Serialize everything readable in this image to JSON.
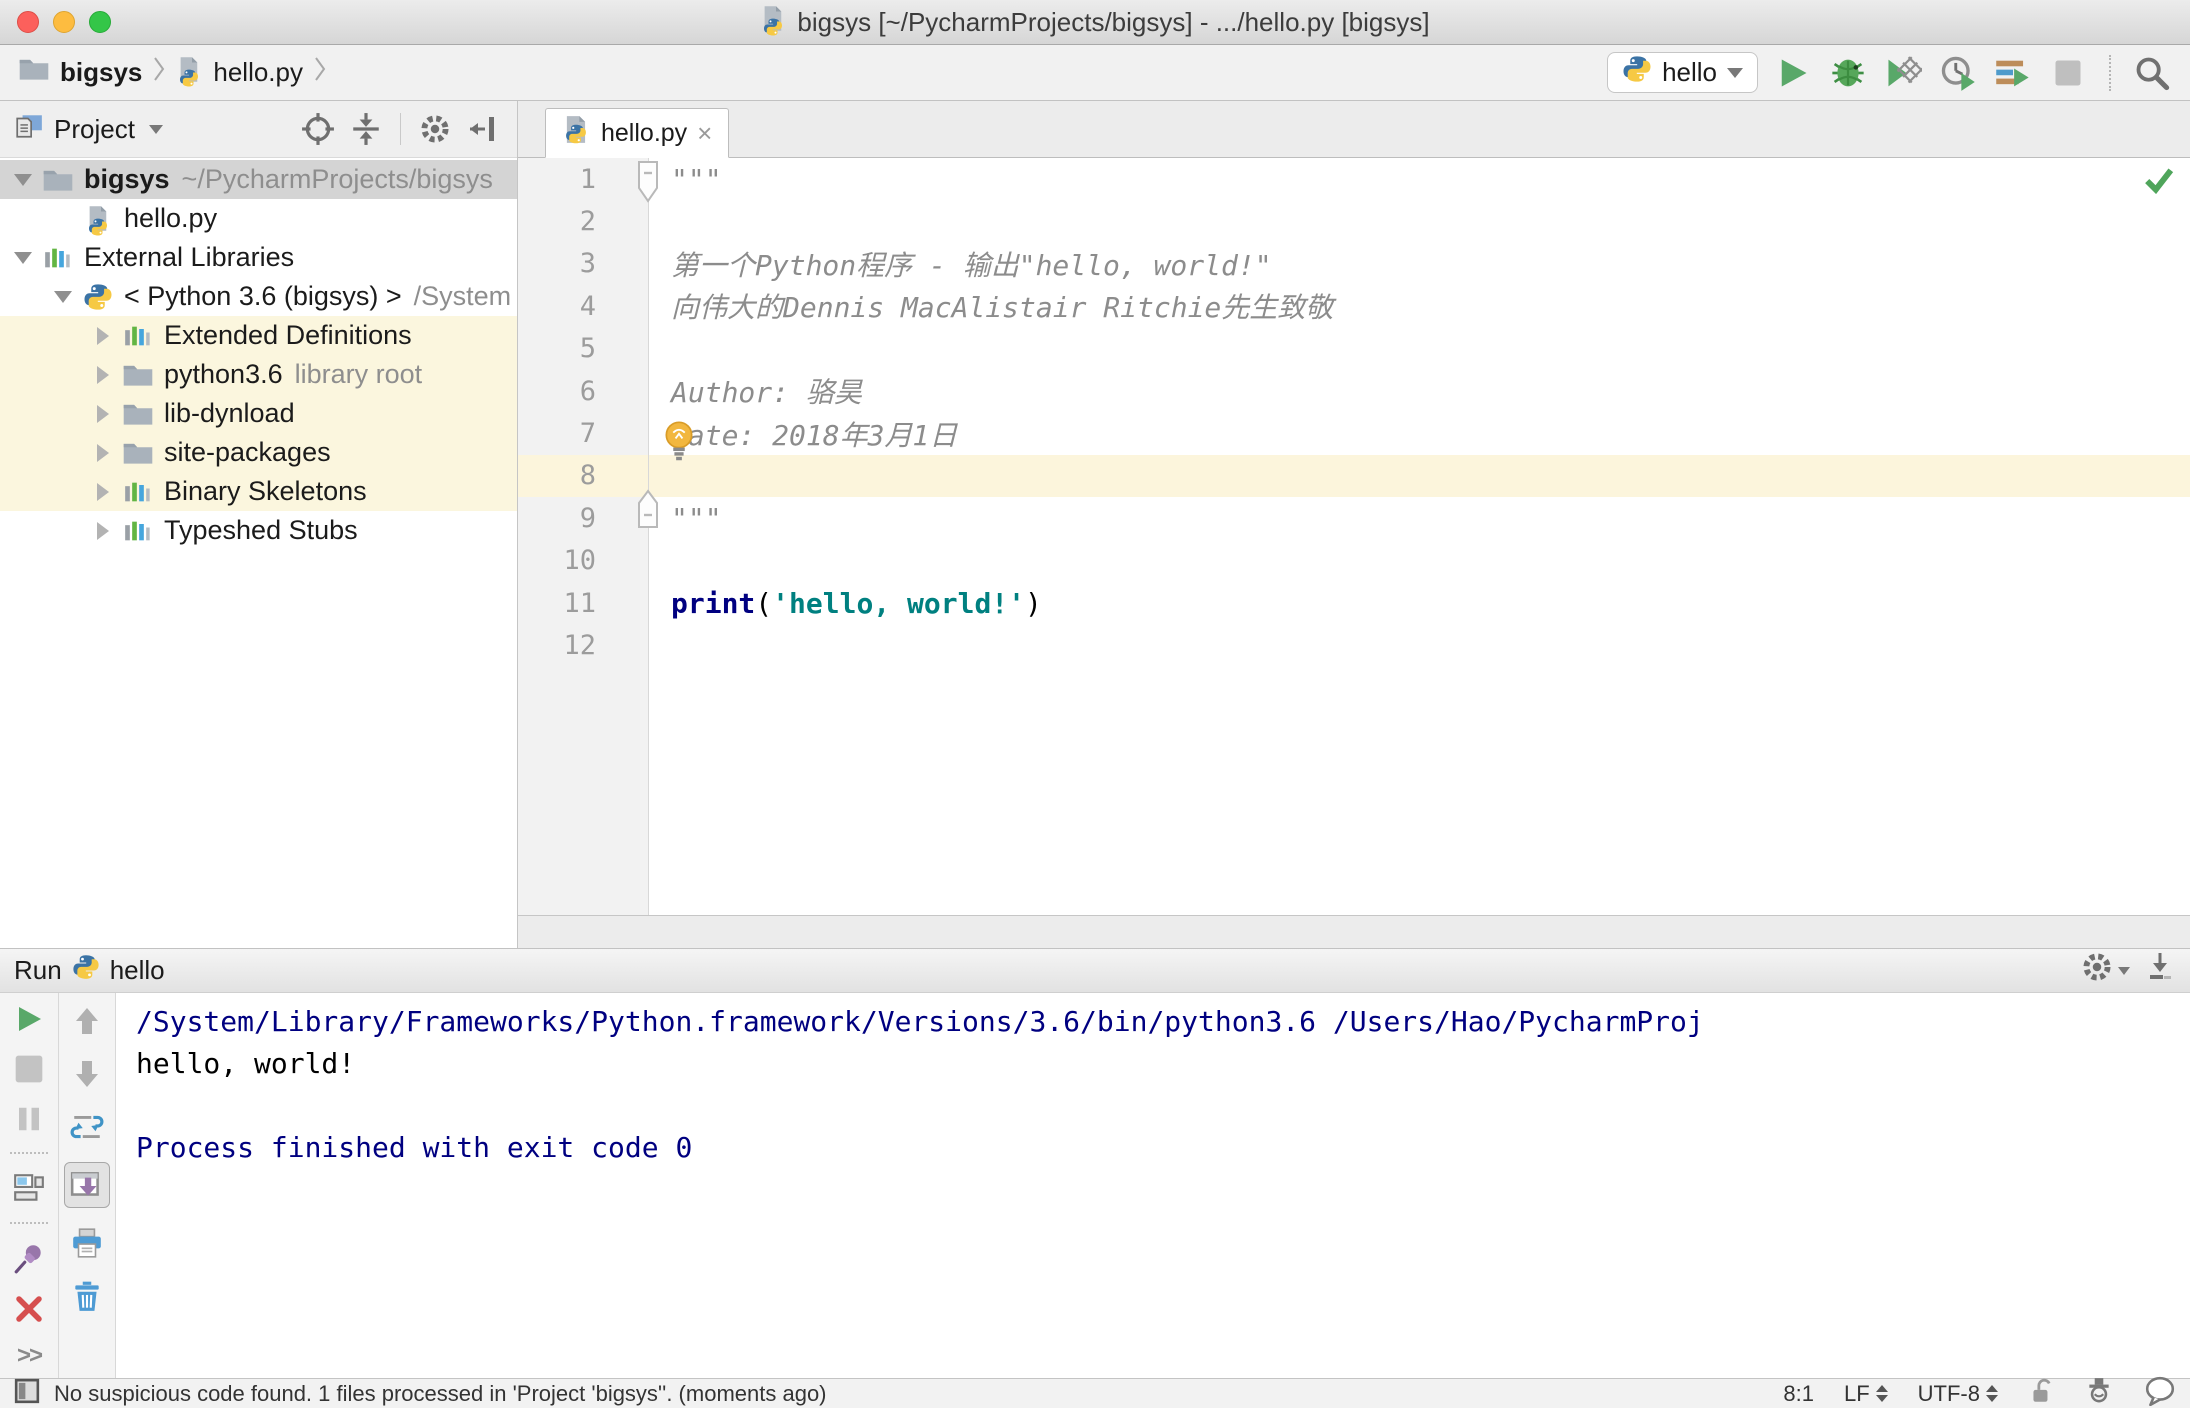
{
  "window": {
    "title": "bigsys [~/PycharmProjects/bigsys] - .../hello.py [bigsys]"
  },
  "toolbar": {
    "breadcrumbs": [
      {
        "label": "bigsys"
      },
      {
        "label": "hello.py"
      }
    ],
    "run_config": {
      "label": "hello"
    }
  },
  "project_panel": {
    "title": "Project",
    "tree": [
      {
        "label": "bigsys",
        "hint": "~/PycharmProjects/bigsys",
        "icon": "folder",
        "indent": 0,
        "arrow": "down",
        "selected": true,
        "bold": true
      },
      {
        "label": "hello.py",
        "icon": "python-file",
        "indent": 1,
        "arrow": "none"
      },
      {
        "label": "External Libraries",
        "icon": "library",
        "indent": 0,
        "arrow": "down"
      },
      {
        "label": "< Python 3.6 (bigsys) >",
        "hint": "/System",
        "icon": "python",
        "indent": 1,
        "arrow": "down"
      },
      {
        "label": "Extended Definitions",
        "icon": "library",
        "indent": 2,
        "arrow": "right",
        "highlight": true
      },
      {
        "label": "python3.6",
        "hint": "library root",
        "icon": "folder",
        "indent": 2,
        "arrow": "right",
        "highlight": true
      },
      {
        "label": "lib-dynload",
        "icon": "folder",
        "indent": 2,
        "arrow": "right",
        "highlight": true
      },
      {
        "label": "site-packages",
        "icon": "folder",
        "indent": 2,
        "arrow": "right",
        "highlight": true
      },
      {
        "label": "Binary Skeletons",
        "icon": "library",
        "indent": 2,
        "arrow": "right",
        "highlight": true
      },
      {
        "label": "Typeshed Stubs",
        "icon": "library",
        "indent": 2,
        "arrow": "right"
      }
    ]
  },
  "editor": {
    "tab_label": "hello.py",
    "caret_position_visible_line": 8,
    "lines": [
      {
        "num": 1,
        "fold": "top",
        "segments": [
          {
            "s": "doc",
            "t": "\"\"\""
          }
        ]
      },
      {
        "num": 2,
        "segments": []
      },
      {
        "num": 3,
        "segments": [
          {
            "s": "doc",
            "t": "第一个Python程序 - 输出\"hello, world!\""
          }
        ]
      },
      {
        "num": 4,
        "segments": [
          {
            "s": "doc",
            "t": "向伟大的Dennis MacAlistair Ritchie先生致敬"
          }
        ]
      },
      {
        "num": 5,
        "segments": []
      },
      {
        "num": 6,
        "segments": [
          {
            "s": "doc",
            "t": "Author: 骆昊"
          }
        ]
      },
      {
        "num": 7,
        "bulb": true,
        "segments": [
          {
            "s": "doc",
            "t": "Date: 2018年3月1日"
          }
        ]
      },
      {
        "num": 8,
        "caret": true,
        "segments": []
      },
      {
        "num": 9,
        "fold": "bottom",
        "segments": [
          {
            "s": "doc",
            "t": "\"\"\""
          }
        ]
      },
      {
        "num": 10,
        "segments": []
      },
      {
        "num": 11,
        "segments": [
          {
            "s": "kw",
            "t": "print"
          },
          {
            "s": "plain",
            "t": "("
          },
          {
            "s": "str",
            "t": "'hello, world!'"
          },
          {
            "s": "plain",
            "t": ")"
          }
        ]
      },
      {
        "num": 12,
        "segments": []
      }
    ]
  },
  "run_panel": {
    "title": "Run",
    "config": "hello",
    "console_lines": [
      {
        "style": "system",
        "text": "/System/Library/Frameworks/Python.framework/Versions/3.6/bin/python3.6 /Users/Hao/PycharmProj"
      },
      {
        "style": "stdout",
        "text": "hello, world!"
      },
      {
        "style": "stdout",
        "text": ""
      },
      {
        "style": "system",
        "text": "Process finished with exit code 0"
      }
    ],
    "more_label": ">>"
  },
  "status_bar": {
    "message": "No suspicious code found. 1 files processed in 'Project 'bigsys''. (moments ago)",
    "caret": "8:1",
    "line_separator": "LF",
    "encoding": "UTF-8"
  },
  "icons": {
    "python_logo": "two-tone blue/yellow snake",
    "run": "green play triangle",
    "debug": "green bug",
    "stop": "gray square",
    "search": "magnifier",
    "settings": "gear",
    "pin": "purple pushpin",
    "close": "red cross",
    "clear_all": "blue trash can",
    "print": "blue printer",
    "inspection_ok": "green checkmark",
    "intention_bulb": "yellow lightbulb"
  },
  "colors": {
    "keyword": "#000080",
    "string": "#008080",
    "docstring": "#8c8c8c",
    "console_system": "#000080",
    "caret_line": "#fcf5dc",
    "library_scope_highlight": "#fbf6de",
    "tree_selection": "#d4d4d4",
    "run_green": "#59a869",
    "python_blue": "#3b73a5",
    "python_yellow": "#f6c944"
  }
}
